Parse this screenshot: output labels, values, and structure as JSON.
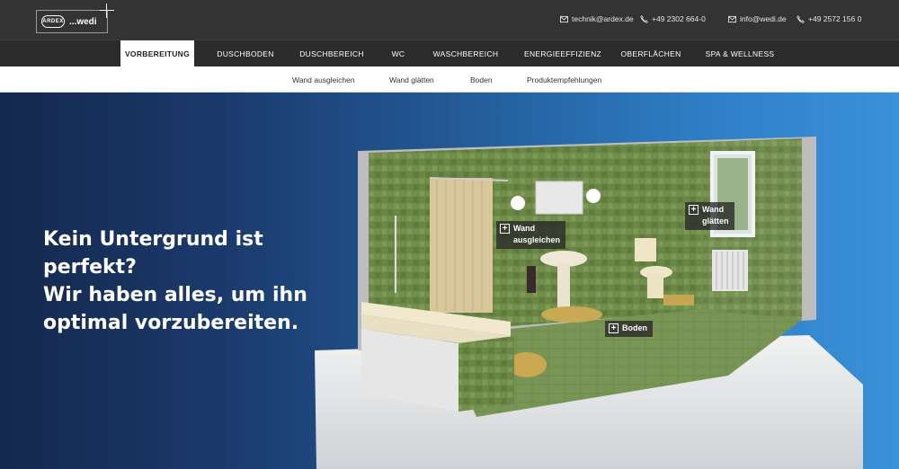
{
  "brand": {
    "logo_left": "ARDEX",
    "logo_right": "...wedi"
  },
  "contacts": [
    {
      "icon": "mail-icon",
      "text": "technik@ardex.de"
    },
    {
      "icon": "phone-icon",
      "text": "+49 2302 664-0"
    },
    {
      "icon": "mail-icon",
      "text": "info@wedi.de"
    },
    {
      "icon": "phone-icon",
      "text": "+49 2572 156 0"
    }
  ],
  "nav": {
    "items": [
      {
        "label": "VORBEREITUNG",
        "active": true
      },
      {
        "label": "DUSCHBODEN"
      },
      {
        "label": "DUSCHBEREICH"
      },
      {
        "label": "WC"
      },
      {
        "label": "WASCHBEREICH"
      },
      {
        "label": "ENERGIEEFFIZIENZ"
      },
      {
        "label": "OBERFLÄCHEN"
      },
      {
        "label": "SPA & WELLNESS"
      }
    ]
  },
  "subnav": {
    "items": [
      "Wand ausgleichen",
      "Wand glätten",
      "Boden",
      "Produktempfehlungen"
    ]
  },
  "hero": {
    "lines": [
      "Kein Untergrund ist",
      "perfekt?",
      "Wir haben alles, um ihn",
      "optimal vorzubereiten."
    ],
    "hotspots": [
      {
        "line1": "Wand",
        "line2": "ausgleichen"
      },
      {
        "line1": "Wand",
        "line2": "glätten"
      },
      {
        "line1": "Boden",
        "line2": ""
      }
    ]
  },
  "colors": {
    "topbar": "#333333",
    "nav": "#2b2b2b",
    "hero_left": "#14284d",
    "hero_right": "#3a92d8",
    "tile_green": "#6f8a4a"
  }
}
